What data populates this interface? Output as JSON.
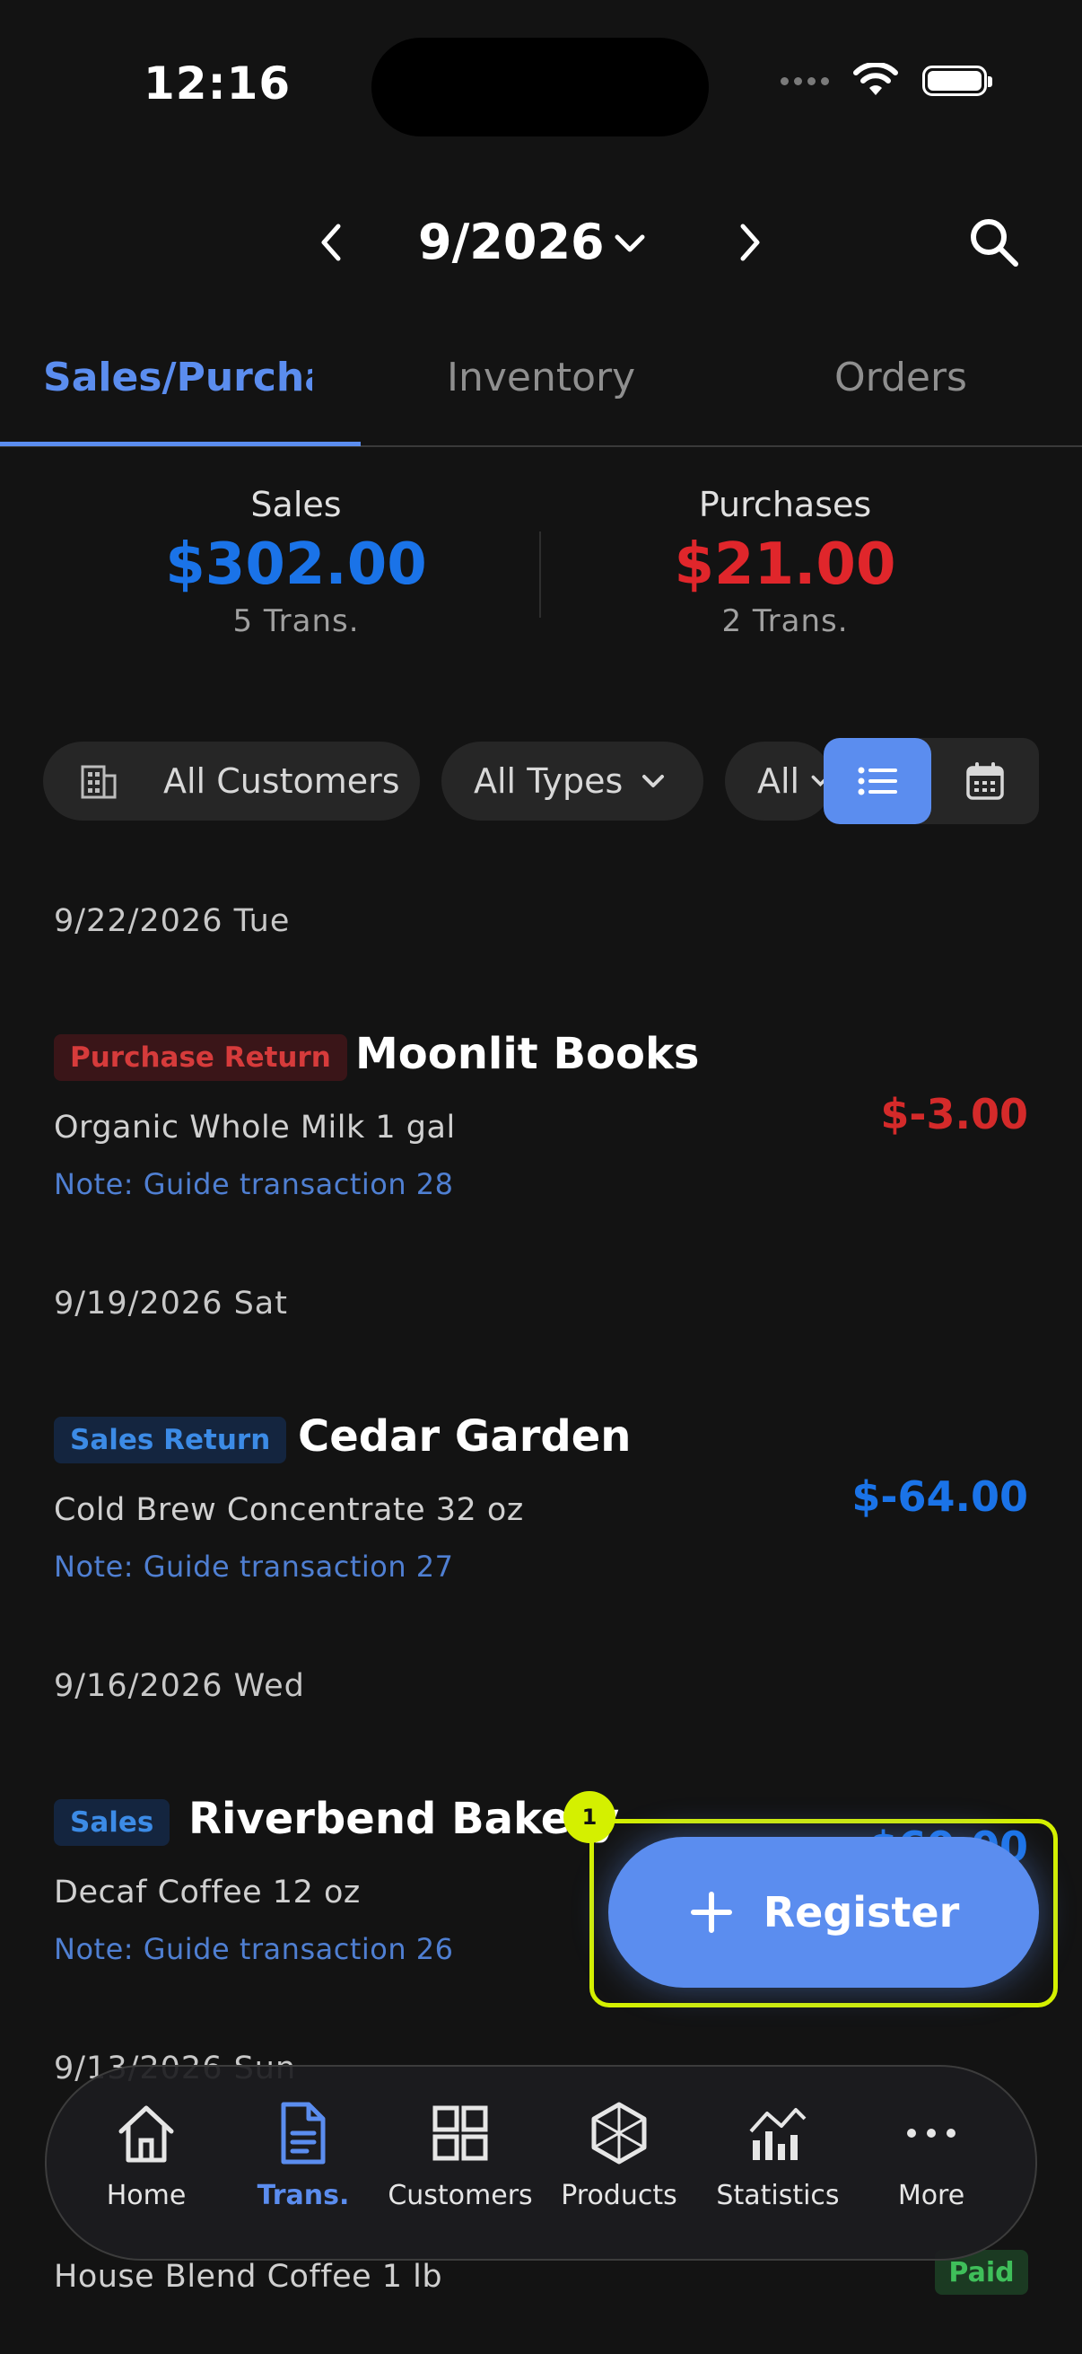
{
  "status_bar": {
    "time": "12:16"
  },
  "header": {
    "month": "9/2026"
  },
  "tabs": [
    {
      "label": "Sales/Purcha",
      "active": true
    },
    {
      "label": "Inventory",
      "active": false
    },
    {
      "label": "Orders",
      "active": false
    }
  ],
  "summary": {
    "sales": {
      "label": "Sales",
      "amount": "$302.00",
      "count": "5 Trans.",
      "color": "#1a73e8"
    },
    "purchases": {
      "label": "Purchases",
      "amount": "$21.00",
      "count": "2 Trans.",
      "color": "#e0262b"
    }
  },
  "filters": {
    "customers": "All Customers",
    "types": "All Types",
    "status": "All",
    "view_mode": "list"
  },
  "transactions": [
    {
      "date": "9/22/2026 Tue",
      "type": "Purchase Return",
      "party": "Moonlit Books",
      "item": "Organic Whole Milk 1 gal",
      "note": "Note: Guide transaction 28",
      "amount": "$-3.00",
      "amount_color": "#d42a2a"
    },
    {
      "date": "9/19/2026 Sat",
      "type": "Sales Return",
      "party": "Cedar Garden",
      "item": "Cold Brew Concentrate 32 oz",
      "note": "Note: Guide transaction 27",
      "amount": "$-64.00",
      "amount_color": "#1a73e8"
    },
    {
      "date": "9/16/2026 Wed",
      "type": "Sales",
      "party": "Riverbend Bakery",
      "item": "Decaf Coffee 12 oz",
      "note": "Note: Guide transaction 26",
      "amount": "$60.00",
      "amount_color": "#1a73e8"
    },
    {
      "date": "9/13/2026 Sun",
      "item": "House Blend Coffee 1 lb",
      "status": "Paid"
    }
  ],
  "fab": {
    "label": "Register",
    "step": "1"
  },
  "bottom_nav": [
    {
      "label": "Home",
      "icon": "home-icon",
      "active": false
    },
    {
      "label": "Trans.",
      "icon": "document-icon",
      "active": true
    },
    {
      "label": "Customers",
      "icon": "grid-icon",
      "active": false
    },
    {
      "label": "Products",
      "icon": "cube-icon",
      "active": false
    },
    {
      "label": "Statistics",
      "icon": "chart-icon",
      "active": false
    },
    {
      "label": "More",
      "icon": "more-icon",
      "active": false
    }
  ]
}
